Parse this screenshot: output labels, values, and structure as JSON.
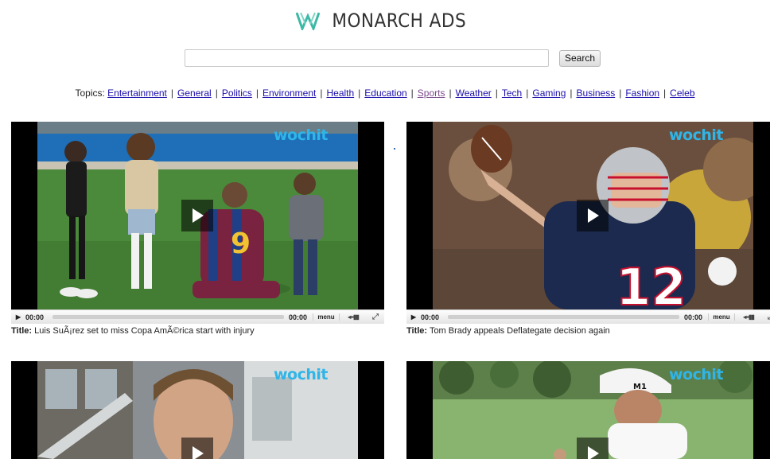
{
  "header": {
    "logo_text": "MONARCH ADS",
    "logo_color": "#3cb9a5"
  },
  "search": {
    "value": "",
    "button_label": "Search"
  },
  "topics": {
    "label": "Topics:",
    "items": [
      "Entertainment",
      "General",
      "Politics",
      "Environment",
      "Health",
      "Education",
      "Sports",
      "Weather",
      "Tech",
      "Gaming",
      "Business",
      "Fashion",
      "Celeb"
    ],
    "visited": "Sports",
    "separator": "|"
  },
  "videos": [
    {
      "brand": "wochit",
      "time_current": "00:00",
      "time_total": "00:00",
      "menu_label": "menu",
      "title_label": "Title:",
      "title": "Luis SuÃ¡rez set to miss Copa AmÃ©rica start with injury"
    },
    {
      "brand": "wochit",
      "time_current": "00:00",
      "time_total": "00:00",
      "menu_label": "menu",
      "title_label": "Title:",
      "title": "Tom Brady appeals Deflategate decision again"
    },
    {
      "brand": "wochit"
    },
    {
      "brand": "wochit"
    }
  ],
  "colors": {
    "link": "#1a0dab",
    "visited_link": "#7a4a8a",
    "brand_watermark": "#2fb5e8"
  }
}
